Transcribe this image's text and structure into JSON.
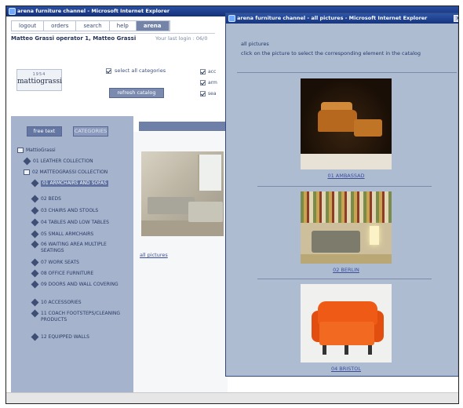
{
  "main_window": {
    "title": "arena furniture channel - Microsoft Internet Explorer",
    "nav": [
      "logout",
      "orders",
      "search",
      "help",
      "arena"
    ],
    "nav_active_index": 4,
    "user_line": "Matteo Grassi operator 1, Matteo Grassi",
    "last_login": "Your last login : 06/0",
    "logo": {
      "top": "1954",
      "brand": "mattiograssi"
    },
    "select_all_label": "select all categories",
    "select_all_checked": true,
    "refresh_button": "refresh catalog",
    "category_labels": [
      "acc",
      "arm",
      "sea"
    ],
    "free_text_button": "free text",
    "categories_button": "CATEGORIES",
    "tree": {
      "root": "MattioGrassi",
      "collections": [
        "01 LEATHER COLLECTION",
        "02 MATTEOGRASSI COLLECTION"
      ],
      "items": [
        "01 ARMCHAIRS AND SOFAS",
        "02 BEDS",
        "03 CHAIRS AND STOOLS",
        "04 TABLES AND LOW TABLES",
        "05 SMALL ARMCHAIRS",
        "06 WAITING AREA MULTIPLE SEATINGS",
        "07 WORK SEATS",
        "08 OFFICE FURNITURE",
        "09 DOORS AND WALL COVERING",
        "10 ACCESSORIES",
        "11 COACH FOOTSTEPS/CLEANING PRODUCTS",
        "12 EQUIPPED WALLS"
      ],
      "selected_index": 0
    },
    "all_pictures_link": "all pictures"
  },
  "popup": {
    "title": "arena furniture channel - all pictures - Microsoft Internet Explorer",
    "close_label": "x",
    "heading": "all pictures",
    "instruction": "click on the picture to select the corresponding element in the catalog",
    "pictures": [
      {
        "caption": "01 AMBASSAD"
      },
      {
        "caption": "02 BERLIN"
      },
      {
        "caption": "04 BRISTOL"
      }
    ]
  }
}
